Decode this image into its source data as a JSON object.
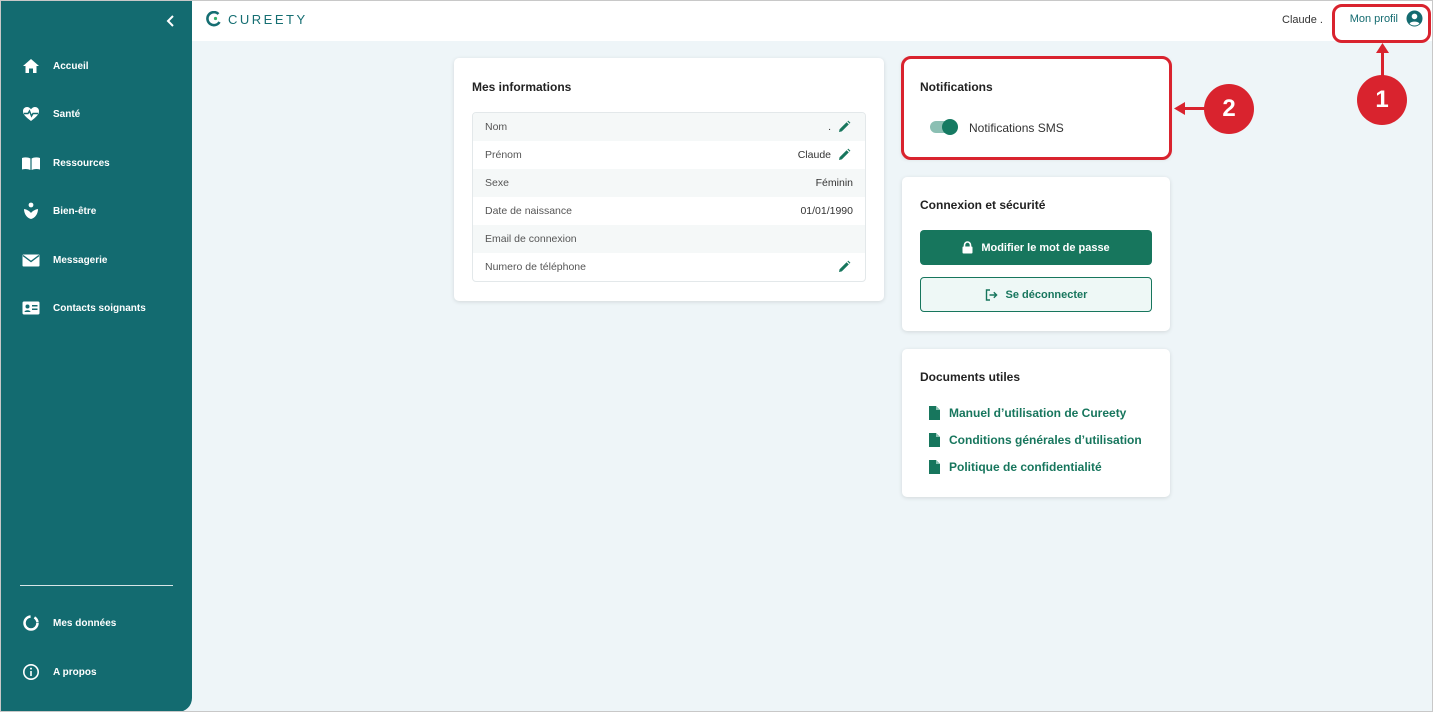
{
  "app": {
    "logo_text": "CUREETY",
    "user_name": "Claude .",
    "profile_label": "Mon profil"
  },
  "sidebar": {
    "items": [
      {
        "label": "Accueil",
        "icon": "home-icon"
      },
      {
        "label": "Santé",
        "icon": "heart-pulse-icon"
      },
      {
        "label": "Ressources",
        "icon": "book-icon"
      },
      {
        "label": "Bien-être",
        "icon": "wellbeing-icon"
      },
      {
        "label": "Messagerie",
        "icon": "mail-icon"
      },
      {
        "label": "Contacts soignants",
        "icon": "contact-card-icon"
      }
    ],
    "bottom_items": [
      {
        "label": "Mes données",
        "icon": "data-ring-icon"
      },
      {
        "label": "A propos",
        "icon": "info-icon"
      }
    ]
  },
  "info_card": {
    "title": "Mes informations",
    "rows": [
      {
        "label": "Nom",
        "value": ".",
        "editable": true
      },
      {
        "label": "Prénom",
        "value": "Claude",
        "editable": true
      },
      {
        "label": "Sexe",
        "value": "Féminin",
        "editable": false
      },
      {
        "label": "Date de naissance",
        "value": "01/01/1990",
        "editable": false
      },
      {
        "label": "Email de connexion",
        "value": "",
        "editable": false
      },
      {
        "label": "Numero de téléphone",
        "value": "",
        "editable": true
      }
    ]
  },
  "notifications_card": {
    "title": "Notifications",
    "sms_label": "Notifications SMS",
    "sms_enabled": true
  },
  "security_card": {
    "title": "Connexion et sécurité",
    "change_password_label": "Modifier le mot de passe",
    "logout_label": "Se déconnecter"
  },
  "documents_card": {
    "title": "Documents utiles",
    "links": [
      "Manuel d’utilisation de Cureety",
      "Conditions générales d’utilisation",
      "Politique de confidentialité"
    ]
  },
  "annotations": {
    "badge_1": "1",
    "badge_2": "2"
  },
  "colors": {
    "sidebar": "#136b70",
    "accent": "#17765d",
    "highlight": "#d9232e"
  }
}
